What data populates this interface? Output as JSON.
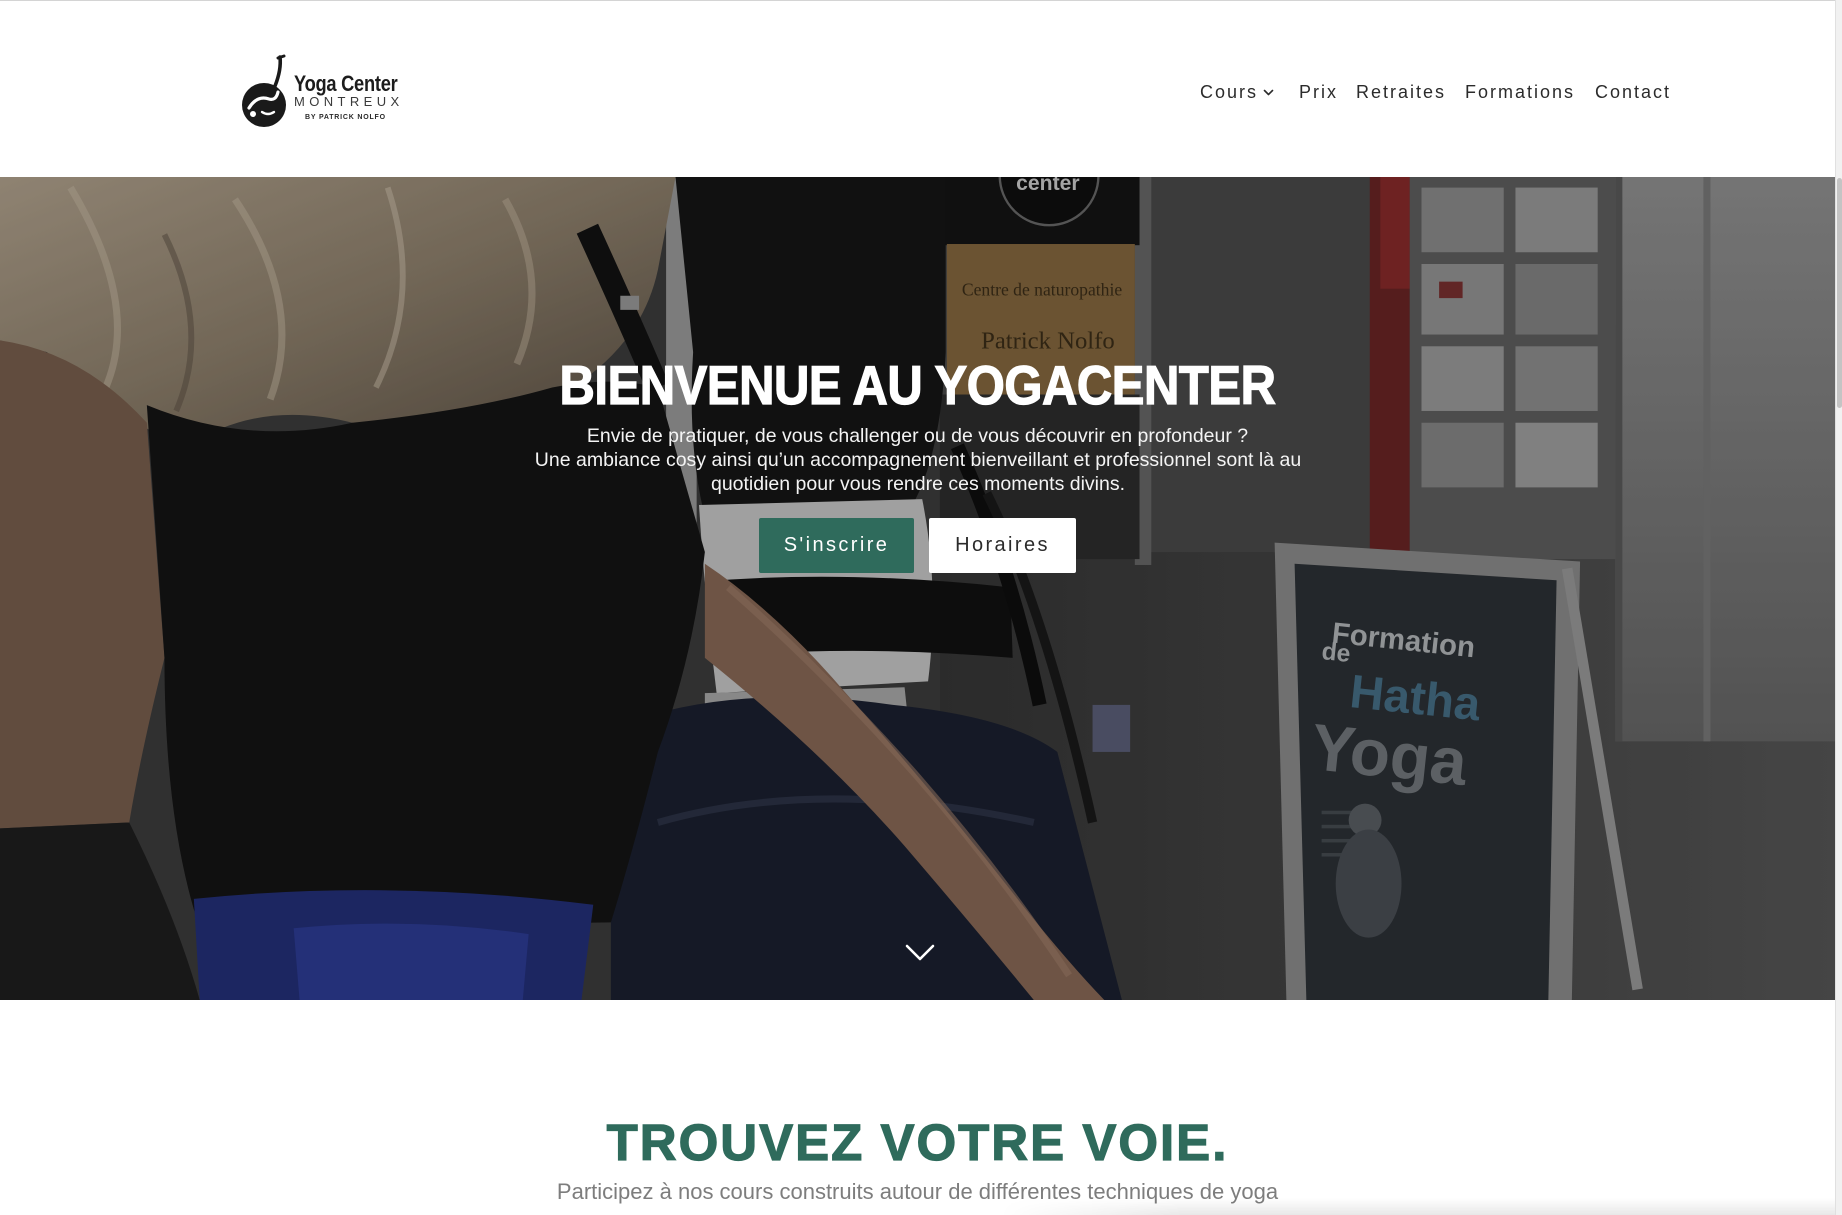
{
  "colors": {
    "accent": "#2f6b5c",
    "nav_text": "#2b2b2b",
    "muted_text": "#7d7d7d",
    "hero_text": "#ffffff",
    "header_background": "#ffffff"
  },
  "header": {
    "logo": {
      "icon": "yoga-figure-logo-icon",
      "title": "Yoga Center",
      "subtitle": "MONTREUX",
      "byline": "BY PATRICK NOLFO"
    },
    "nav": [
      {
        "label": "Cours",
        "icon": "chevron-down-icon"
      },
      {
        "label": "Prix"
      },
      {
        "label": "Retraites"
      },
      {
        "label": "Formations"
      },
      {
        "label": "Contact"
      }
    ]
  },
  "hero": {
    "title": "BIENVENUE AU YOGACENTER",
    "intro": "Envie de pratiquer, de vous challenger ou de vous découvrir en profondeur ?",
    "description": "Une ambiance cosy ainsi qu’un accompagnement bienveillant et professionnel sont là au quotidien pour vous rendre ces moments divins.",
    "primary_button": "S'inscrire",
    "secondary_button": "Horaires",
    "scroll_icon": "chevron-down-icon",
    "photo_signs": {
      "top_sign": "center",
      "shop_line1": "Centre de naturopathie",
      "shop_line2": "Patrick Nolfo",
      "board_line1": "Formation",
      "board_line2": "de",
      "board_line3": "Hatha",
      "board_line4": "Yoga"
    }
  },
  "intro_section": {
    "title": "TROUVEZ VOTRE VOIE.",
    "subtitle": "Participez à nos cours construits autour de différentes techniques de yoga"
  }
}
